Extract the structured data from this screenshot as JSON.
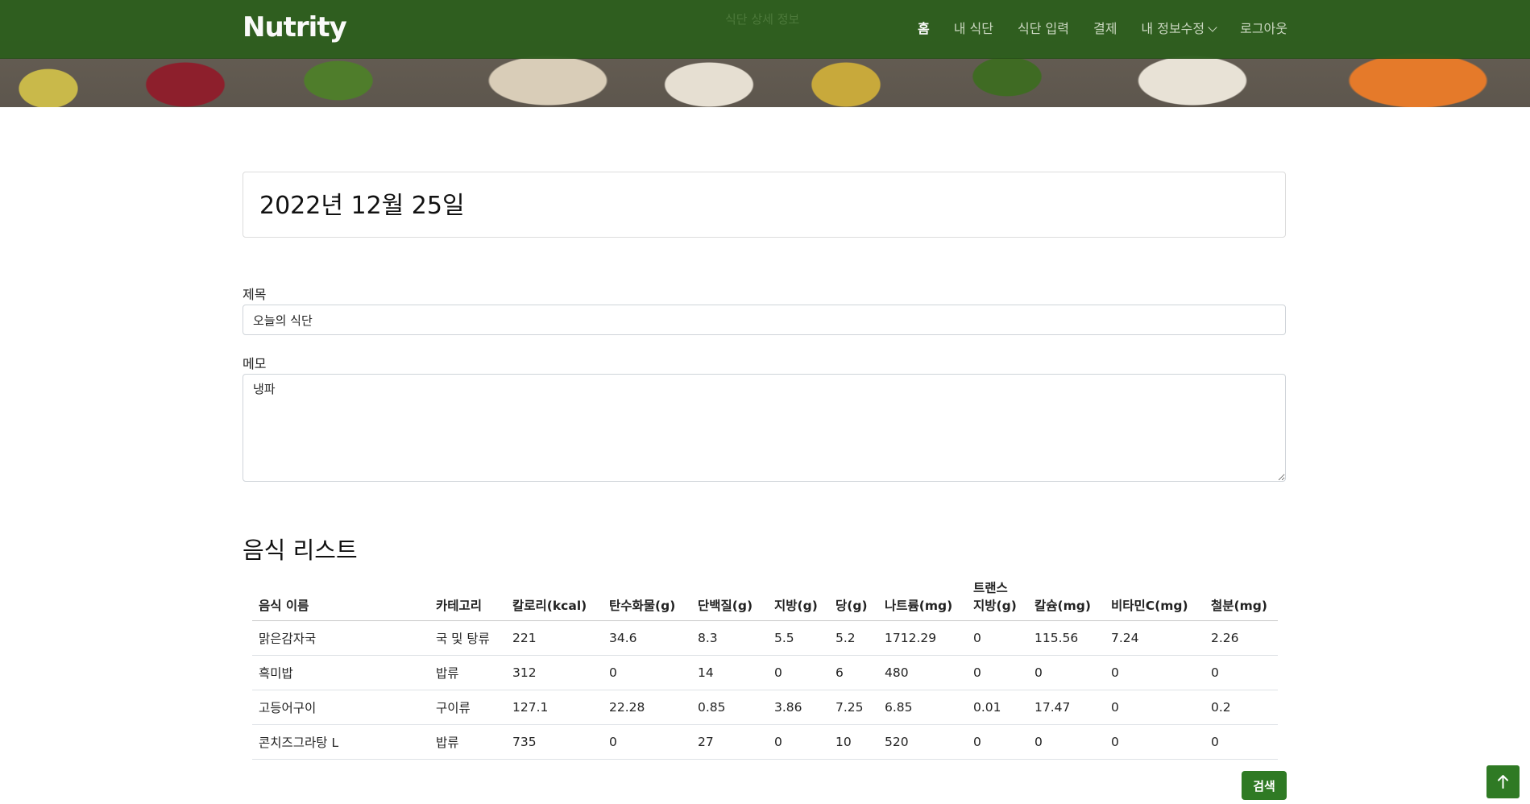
{
  "app": {
    "brand": "Nutrity",
    "page_heading": "식단 상세 정보"
  },
  "nav": {
    "items": [
      {
        "label": "홈",
        "active": true
      },
      {
        "label": "내 식단"
      },
      {
        "label": "식단 입력"
      },
      {
        "label": "결제"
      },
      {
        "label": "내 정보수정",
        "dropdown": true
      },
      {
        "label": "로그아웃"
      }
    ]
  },
  "diet": {
    "date": "2022년 12월 25일",
    "title_label": "제목",
    "title_value": "오늘의 식단",
    "memo_label": "메모",
    "memo_value": "냉파"
  },
  "food_list": {
    "heading": "음식 리스트",
    "columns": [
      "음식 이름",
      "카테고리",
      "칼로리(kcal)",
      "탄수화물(g)",
      "단백질(g)",
      "지방(g)",
      "당(g)",
      "나트륨(mg)",
      "트랜스\n지방(g)",
      "칼슘(mg)",
      "비타민C(mg)",
      "철분(mg)"
    ],
    "rows": [
      [
        "맑은감자국",
        "국 및 탕류",
        "221",
        "34.6",
        "8.3",
        "5.5",
        "5.2",
        "1712.29",
        "0",
        "115.56",
        "7.24",
        "2.26"
      ],
      [
        "흑미밥",
        "밥류",
        "312",
        "0",
        "14",
        "0",
        "6",
        "480",
        "0",
        "0",
        "0",
        "0"
      ],
      [
        "고등어구이",
        "구이류",
        "127.1",
        "22.28",
        "0.85",
        "3.86",
        "7.25",
        "6.85",
        "0.01",
        "17.47",
        "0",
        "0.2"
      ],
      [
        "콘치즈그라탕 L",
        "밥류",
        "735",
        "0",
        "27",
        "0",
        "10",
        "520",
        "0",
        "0",
        "0",
        "0"
      ]
    ]
  },
  "buttons": {
    "search": "검색",
    "scroll_top_icon": "arrow-up-icon"
  },
  "colors": {
    "nav_bg": "#2e5e1e",
    "accent": "#2f7a24"
  }
}
